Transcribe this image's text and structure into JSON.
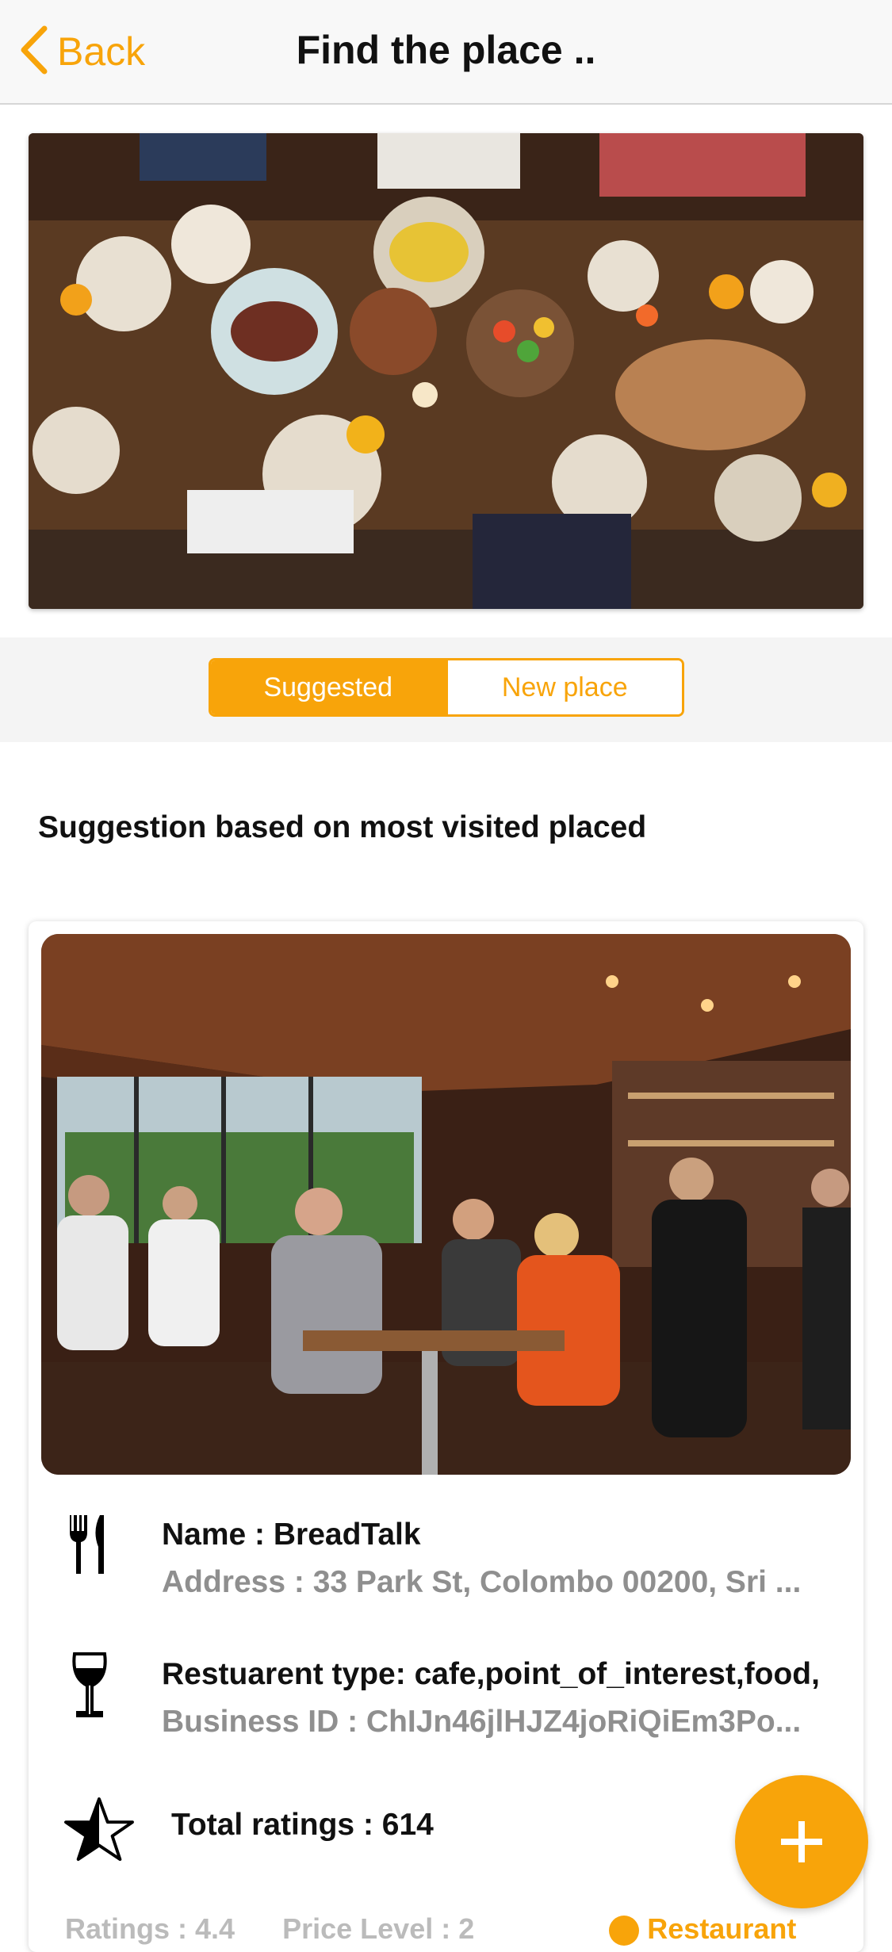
{
  "nav": {
    "back_label": "Back",
    "title": "Find the place .."
  },
  "segments": [
    {
      "label": "Suggested",
      "active": true
    },
    {
      "label": "New place",
      "active": false
    }
  ],
  "section_heading": "Suggestion based on most visited placed",
  "place": {
    "name_line": "Name : BreadTalk",
    "address_line": "Address : 33 Park St, Colombo 00200, Sri ...",
    "type_line": "Restuarent type: cafe,point_of_interest,food,",
    "business_line": "Business ID : ChIJn46jlHJZ4joRiQiEm3Po...",
    "total_ratings_line": "Total ratings : 614",
    "ratings_line": "Ratings : 4.4",
    "price_level_line": "Price Level : 2",
    "status_label": "Restaurant"
  },
  "icons": {
    "back": "chevron-left-icon",
    "cutlery": "cutlery-icon",
    "wine": "wine-glass-icon",
    "star": "half-star-icon",
    "fab": "plus-icon"
  },
  "colors": {
    "accent": "#f8a40a",
    "muted_text": "#8f8f8f"
  }
}
